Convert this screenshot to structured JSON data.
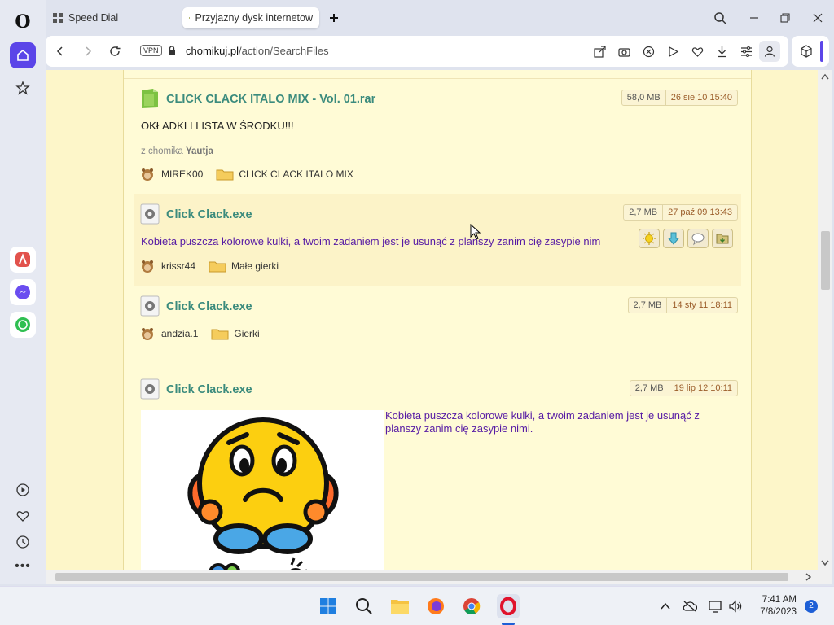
{
  "browser": {
    "tabs": [
      {
        "label": "Speed Dial"
      },
      {
        "label": "Przyjazny dysk internetow"
      }
    ],
    "vpn_label": "VPN",
    "url_domain": "chomikuj.pl",
    "url_path": "/action/SearchFiles"
  },
  "results": [
    {
      "title": "CLICK CLACK ITALO MIX - Vol. 01.rar",
      "size": "58,0 MB",
      "date": "26 sie 10 15:40",
      "description": "OKŁADKI I LISTA W ŚRODKU!!!",
      "from_prefix": "z chomika",
      "from_user": "Yautja",
      "owner": "MIREK00",
      "folder": "CLICK CLACK ITALO MIX"
    },
    {
      "title": "Click Clack.exe",
      "size": "2,7 MB",
      "date": "27 paź 09 13:43",
      "description": "Kobieta puszcza kolorowe kulki, a twoim zadaniem jest je usunąć z planszy zanim cię zasypie nim",
      "owner": "krissr44",
      "folder": "Małe gierki"
    },
    {
      "title": "Click Clack.exe",
      "size": "2,7 MB",
      "date": "14 sty 11 18:11",
      "owner": "andzia.1",
      "folder": "Gierki"
    },
    {
      "title": "Click Clack.exe",
      "size": "2,7 MB",
      "date": "19 lip 12 10:11",
      "description_line1": "Kobieta puszcza kolorowe kulki, a twoim zadaniem jest je usunąć z",
      "description_line2": "planszy zanim cię zasypie nimi."
    }
  ],
  "taskbar": {
    "time": "7:41 AM",
    "date": "7/8/2023",
    "notifications": "2"
  },
  "colors": {
    "accent": "#5b45e8",
    "title": "#3b8b7d",
    "description": "#561aa4"
  }
}
